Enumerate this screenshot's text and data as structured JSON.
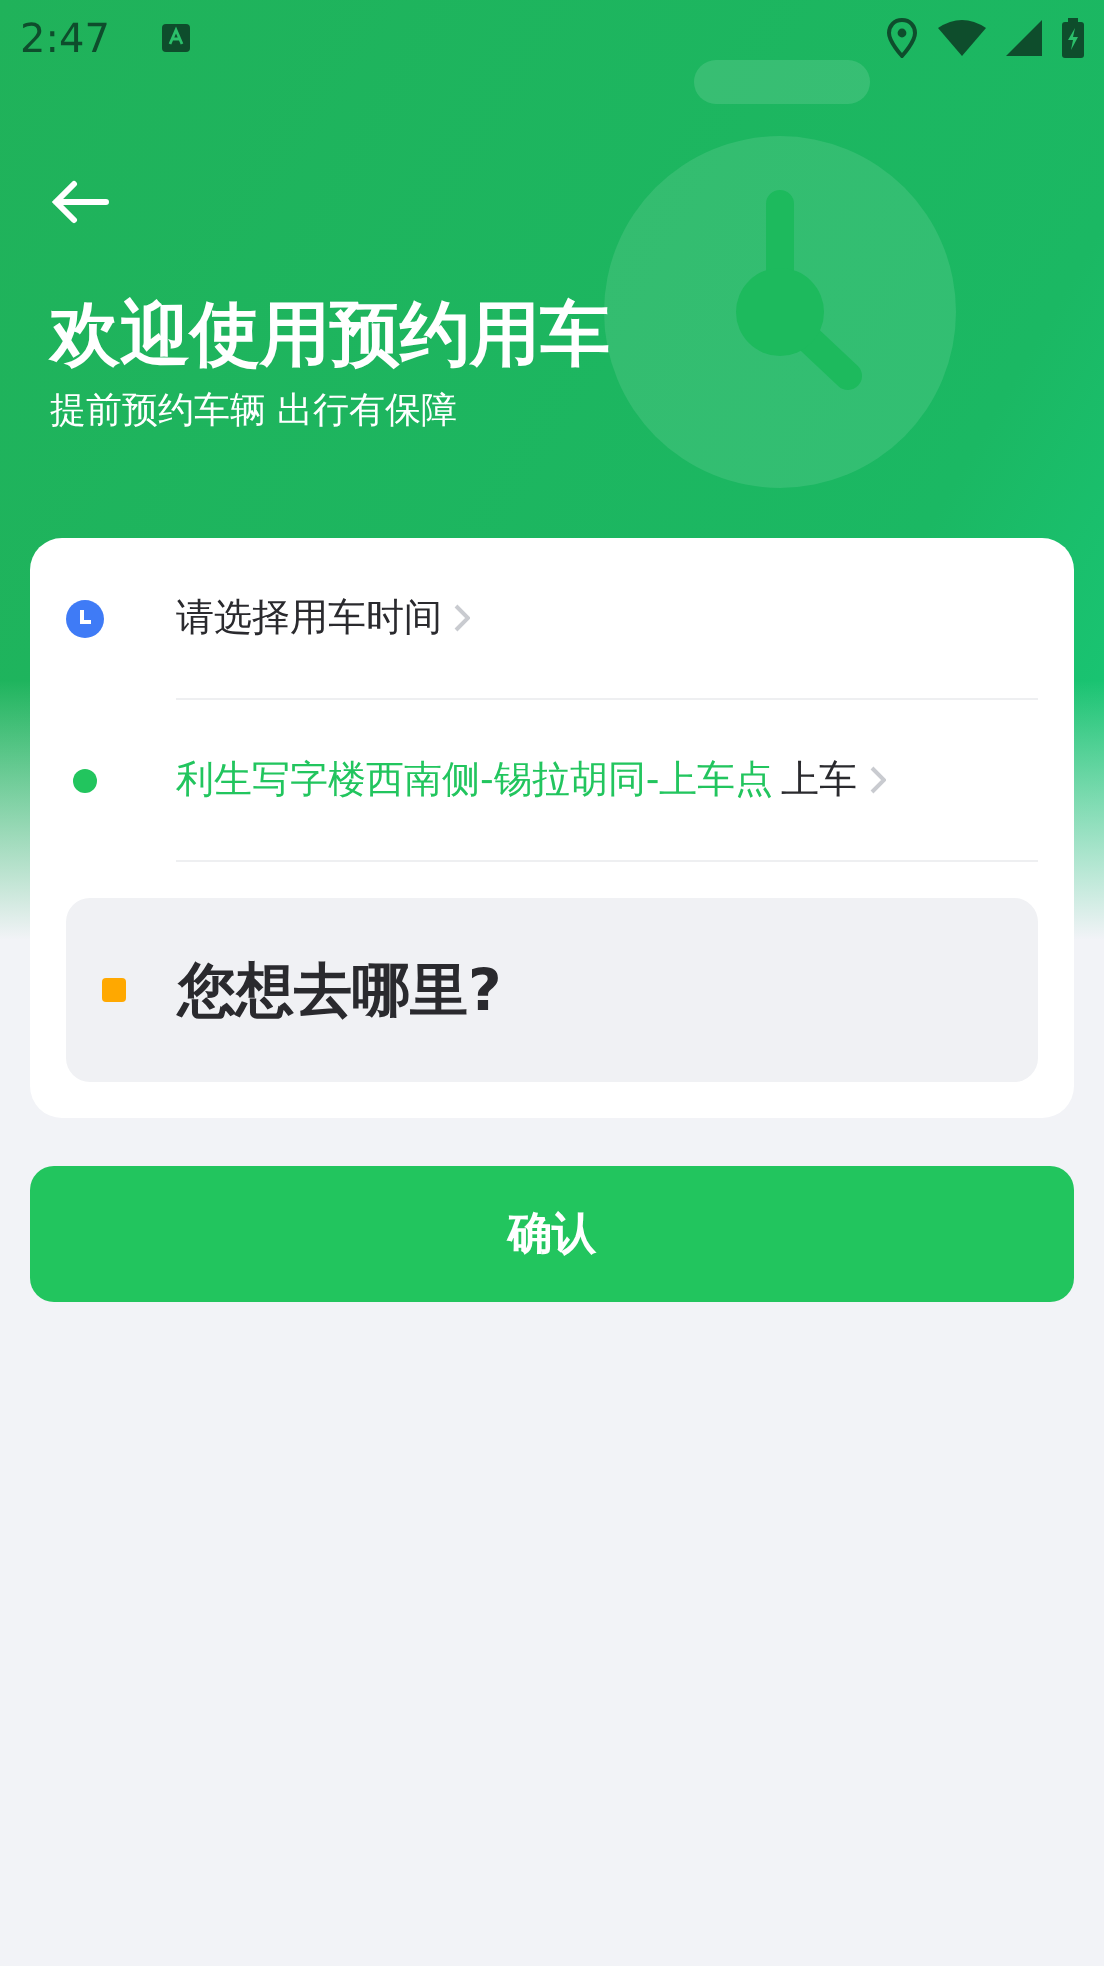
{
  "status_bar": {
    "time": "2:47"
  },
  "header": {
    "title": "欢迎使用预约用车",
    "subtitle": "提前预约车辆 出行有保障"
  },
  "form": {
    "time": {
      "label": "请选择用车时间"
    },
    "pickup": {
      "place": "利生写字楼西南侧-锡拉胡同-上车点",
      "suffix": "上车"
    },
    "destination": {
      "label": "您想去哪里?"
    }
  },
  "confirm_button": "确认"
}
